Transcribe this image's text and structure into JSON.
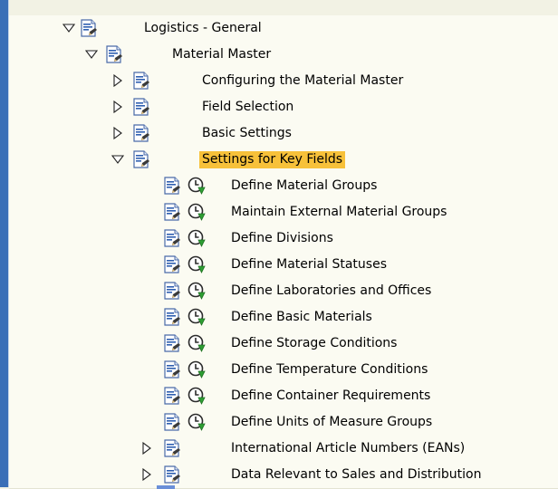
{
  "tree": [
    {
      "level": 0,
      "expanded": true,
      "label": "Logistics - General",
      "activity": false,
      "selected": false
    },
    {
      "level": 1,
      "expanded": true,
      "label": "Material Master",
      "activity": false,
      "selected": false
    },
    {
      "level": 2,
      "expanded": false,
      "label": "Configuring the Material Master",
      "activity": false,
      "selected": false
    },
    {
      "level": 2,
      "expanded": false,
      "label": "Field Selection",
      "activity": false,
      "selected": false
    },
    {
      "level": 2,
      "expanded": false,
      "label": "Basic Settings",
      "activity": false,
      "selected": false
    },
    {
      "level": 2,
      "expanded": true,
      "label": "Settings for Key Fields",
      "activity": false,
      "selected": true
    },
    {
      "level": 3,
      "label": "Define Material Groups",
      "activity": true
    },
    {
      "level": 3,
      "label": "Maintain External Material Groups",
      "activity": true
    },
    {
      "level": 3,
      "label": "Define Divisions",
      "activity": true
    },
    {
      "level": 3,
      "label": "Define Material Statuses",
      "activity": true
    },
    {
      "level": 3,
      "label": "Define Laboratories and Offices",
      "activity": true
    },
    {
      "level": 3,
      "label": "Define Basic Materials",
      "activity": true
    },
    {
      "level": 3,
      "label": "Define Storage Conditions",
      "activity": true
    },
    {
      "level": 3,
      "label": "Define Temperature Conditions",
      "activity": true
    },
    {
      "level": 3,
      "label": "Define Container Requirements",
      "activity": true
    },
    {
      "level": 3,
      "label": "Define Units of Measure Groups",
      "activity": true
    },
    {
      "level": 3,
      "expanded": false,
      "label": "International Article Numbers (EANs)",
      "activity": false,
      "selected": false
    },
    {
      "level": 3,
      "expanded": false,
      "label": "Data Relevant to Sales and Distribution",
      "activity": false,
      "selected": false
    }
  ],
  "colors": {
    "selected_highlight": "#f7c13a",
    "left_bar": "#3a6fb7",
    "background": "#f2f2e4"
  }
}
